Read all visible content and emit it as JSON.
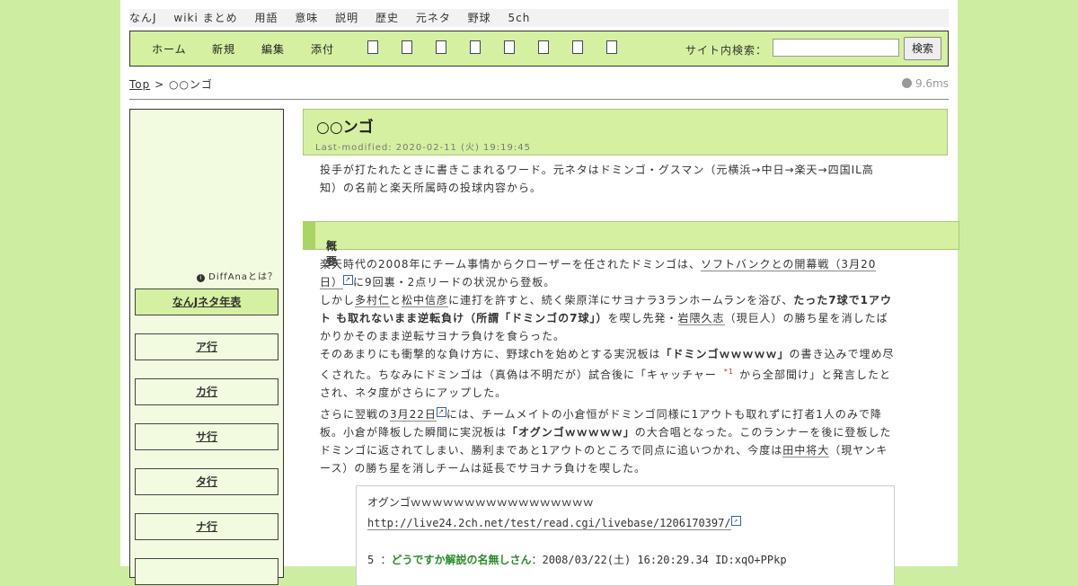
{
  "topbar": [
    "なんJ",
    "wiki まとめ",
    "用語",
    "意味",
    "説明",
    "歴史",
    "元ネタ",
    "野球",
    "5ch"
  ],
  "menu": {
    "home": "ホーム",
    "new": "新規",
    "edit": "編集",
    "attach": "添付",
    "search_label": "サイト内検索：",
    "search_value": "",
    "search_button": "検索"
  },
  "breadcrumb": {
    "top": "Top",
    "sep": ">",
    "page": "○○ンゴ"
  },
  "timing": "9.6ms",
  "sidebar": {
    "diff": "DiffAnaとは？",
    "items": [
      "なんJネタ年表",
      "ア行",
      "カ行",
      "サ行",
      "タ行",
      "ナ行"
    ]
  },
  "article": {
    "title": "○○ンゴ",
    "last_modified": "Last-modified: 2020-02-11 (火) 19:19:45",
    "intro_1": "投手が打たれたときに書きこまれるワード。元ネタはドミンゴ・グスマン（元横浜→中日→楽天→四国IL高",
    "intro_2": "知）の名前と楽天所属時の投球内容から。",
    "section": "概要",
    "p1_a": "楽天時代の2008年にチーム事情からクローザーを任されたドミンゴは、",
    "p1_link": "ソフトバンクとの開幕戦（3月20",
    "p1_link2": "日）",
    "p1_b": "に9回裏・2点リードの状況から登板。",
    "p2_a": "しかし",
    "p2_l1": "多村仁",
    "p2_b": "と",
    "p2_l2": "松中信彦",
    "p2_c": "に連打を許すと、続く柴原洋にサヨナラ3ランホームランを浴び、",
    "p2_bold": "たった7球で1アウ",
    "p2_bold2": "ト も取れないまま逆転負け（所謂「ドミンゴの7球」）",
    "p2_d": "を喫し先発・",
    "p2_l3": "岩隈久志",
    "p2_e": "（現巨人）の勝ち星を消したば",
    "p2_f": "かりかそのまま逆転サヨナラ負けを食らった。",
    "p3_a": "そのあまりにも衝撃的な負け方に、野球chを始めとする実況板は",
    "p3_bold": "「ドミンゴｗｗｗｗｗ」",
    "p3_b": "の書き込みで埋め尽",
    "p3_c": "くされた。ちなみにドミンゴは（真偽は不明だが）試合後に「キャッチャー",
    "p3_note": "*1",
    "p3_d": "から全部聞け」と発言したと",
    "p3_e": "され、ネタ度がさらにアップした。",
    "p4_a": "さらに翌戦の",
    "p4_link": "3月22日",
    "p4_b": "には、チームメイトの小倉恒がドミンゴ同様に1アウトも取れずに打者1人のみで降",
    "p4_c": "板。小倉が降板した瞬間に実況板は",
    "p4_bold": "「オグンゴｗｗｗｗｗ」",
    "p4_d": "の大合唱となった。このランナーを後に登板した",
    "p4_e": "ドミンゴに返されてしまい、勝利まであと1アウトのところで同点に追いつかれ、今度は",
    "p4_l": "田中将大",
    "p4_f": "（現ヤンキ",
    "p4_g": "ース）の勝ち星を消しチームは延長でサヨナラ負けを喫した。"
  },
  "quote": {
    "line1": "オグンゴｗｗｗｗｗｗｗｗｗｗｗｗｗｗｗｗｗ",
    "url": "http://live24.2ch.net/test/read.cgi/livebase/1206170397/",
    "post_no": "5 ：",
    "post_name": "どうですか解説の名無しさん",
    "post_meta": "：2008/03/22(土) 16:20:29.34 ID:xqO+PPkp"
  }
}
